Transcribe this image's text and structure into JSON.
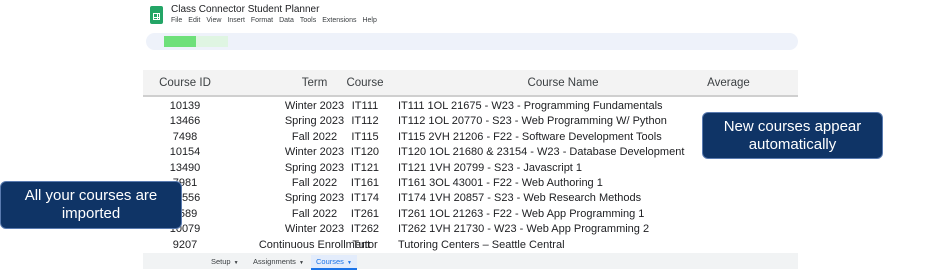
{
  "app": {
    "title": "Class Connector Student Planner"
  },
  "menu": [
    "File",
    "Edit",
    "View",
    "Insert",
    "Format",
    "Data",
    "Tools",
    "Extensions",
    "Help"
  ],
  "table": {
    "headers": [
      "Course ID",
      "Term",
      "Course",
      "Course Name",
      "Average"
    ],
    "rows": [
      [
        "10139",
        "Winter 2023",
        "IT111",
        "IT111 1OL 21675 - W23 - Programming Fundamentals",
        ""
      ],
      [
        "13466",
        "Spring 2023",
        "IT112",
        "IT112 1OL 20770 - S23 - Web Programming W/ Python",
        ""
      ],
      [
        "7498",
        "Fall 2022",
        "IT115",
        "IT115 2VH 21206 - F22 - Software Development Tools",
        ""
      ],
      [
        "10154",
        "Winter 2023",
        "IT120",
        "IT120 1OL 21680 & 23154 - W23 - Database Development",
        ""
      ],
      [
        "13490",
        "Spring 2023",
        "IT121",
        "IT121 1VH 20799 - S23 - Javascript 1",
        ""
      ],
      [
        "7981",
        "Fall 2022",
        "IT161",
        "IT161 3OL 43001 - F22 - Web Authoring 1",
        ""
      ],
      [
        "13556",
        "Spring 2023",
        "IT174",
        "IT174 1VH 20857 - S23 - Web Research Methods",
        ""
      ],
      [
        "7589",
        "Fall 2022",
        "IT261",
        "IT261 1OL 21263 - F22 - Web App Programming 1",
        ""
      ],
      [
        "10079",
        "Winter 2023",
        "IT262",
        "IT262 1VH 21730 - W23 - Web App Programming 2",
        ""
      ],
      [
        "9207",
        "Continuous Enrollment",
        "Tutor",
        "Tutoring Centers – Seattle Central",
        ""
      ]
    ]
  },
  "tabs": [
    {
      "label": "Setup",
      "active": false
    },
    {
      "label": "Assignments",
      "active": false
    },
    {
      "label": "Courses",
      "active": true
    }
  ],
  "callouts": {
    "right": {
      "line1": "New courses appear",
      "line2": "automatically"
    },
    "left": {
      "line1": "All your courses are",
      "line2": "imported"
    }
  },
  "colors": {
    "callout_bg": "#0f3466",
    "sheets_green": "#23a566",
    "active_tab": "#1a73e8"
  }
}
